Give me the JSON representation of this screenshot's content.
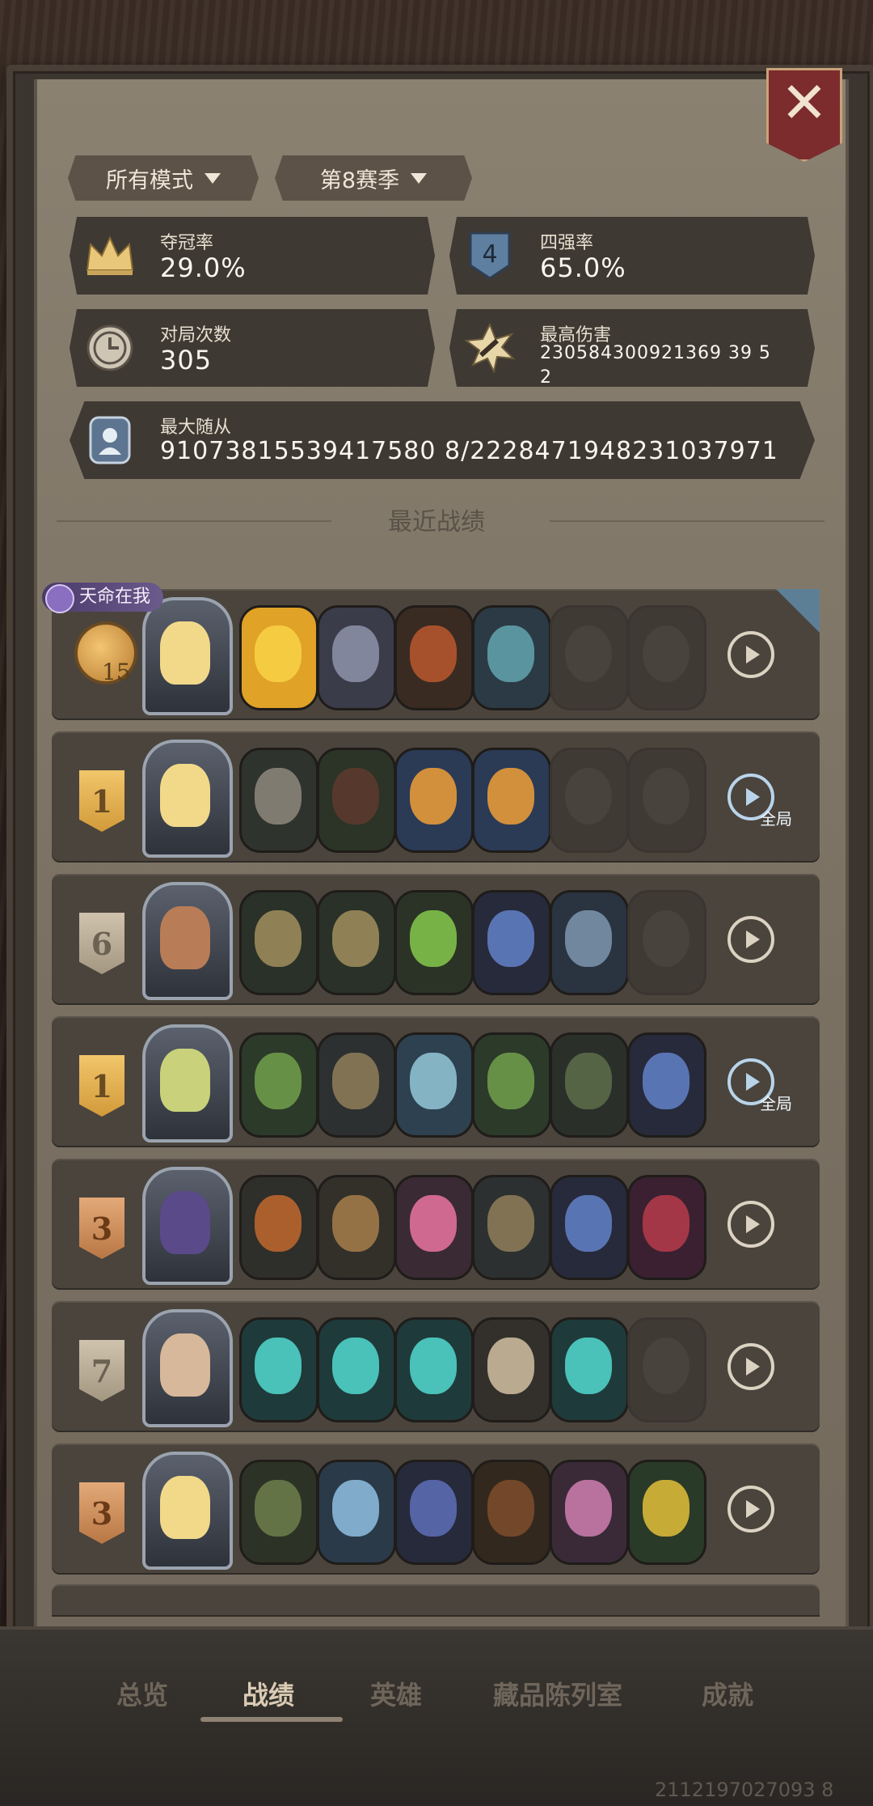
{
  "filters": {
    "mode": "所有模式",
    "season": "第8赛季"
  },
  "stats": {
    "win_rate": {
      "label": "夺冠率",
      "value": "29.0%"
    },
    "top4_rate": {
      "label": "四强率",
      "value": "65.0%"
    },
    "games": {
      "label": "对局次数",
      "value": "305"
    },
    "max_damage": {
      "label": "最高伤害",
      "value": "230584300921369 39 52"
    },
    "max_minion": {
      "label": "最大随从",
      "value": "91073815539417580 8/2228471948231037971"
    }
  },
  "section_title": "最近战绩",
  "destiny_tag": "天命在我",
  "matches": [
    {
      "rank": "",
      "timer": "15",
      "full_label": ""
    },
    {
      "rank": "1",
      "full_label": "全局"
    },
    {
      "rank": "6",
      "full_label": ""
    },
    {
      "rank": "1",
      "full_label": "全局"
    },
    {
      "rank": "3",
      "full_label": ""
    },
    {
      "rank": "7",
      "full_label": ""
    },
    {
      "rank": "3",
      "full_label": ""
    }
  ],
  "tabs": {
    "overview": "总览",
    "record": "战绩",
    "heroes": "英雄",
    "collection": "藏品陈列室",
    "achievements": "成就"
  },
  "watermark": "2112197027093 8",
  "colors": {
    "gold": "#d29a3a",
    "silver": "#a39781",
    "bronze": "#b87745",
    "panel": "#7a7062"
  }
}
